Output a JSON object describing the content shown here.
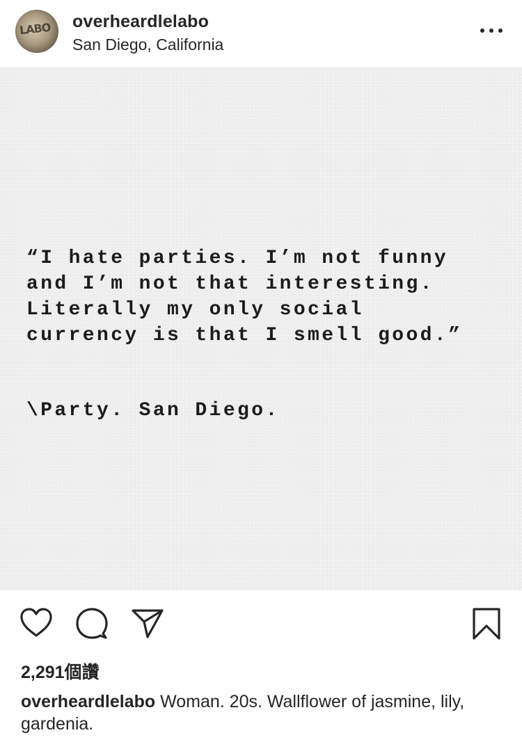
{
  "post": {
    "header": {
      "username": "overheardlelabo",
      "location": "San Diego, California",
      "avatar_icon": "brand-logo-avatar",
      "avatar_text": "LABO",
      "more_icon": "more-options-icon"
    },
    "image": {
      "quote": "“I hate parties. I’m not funny\nand I’m not that interesting.\nLiterally my only social\ncurrency is that I smell good.”",
      "tag": "\\Party. San Diego."
    },
    "actions": {
      "like_icon": "heart-icon",
      "comment_icon": "comment-bubble-icon",
      "share_icon": "paper-plane-icon",
      "save_icon": "bookmark-icon"
    },
    "likes_text": "2,291個讚",
    "caption": {
      "username": "overheardlelabo",
      "text": " Woman. 20s. Wallflower of jasmine, lily, gardenia."
    },
    "colors": {
      "text": "#262626",
      "background": "#ffffff",
      "paper": "#efefef",
      "divider": "#e6e6e6"
    }
  }
}
